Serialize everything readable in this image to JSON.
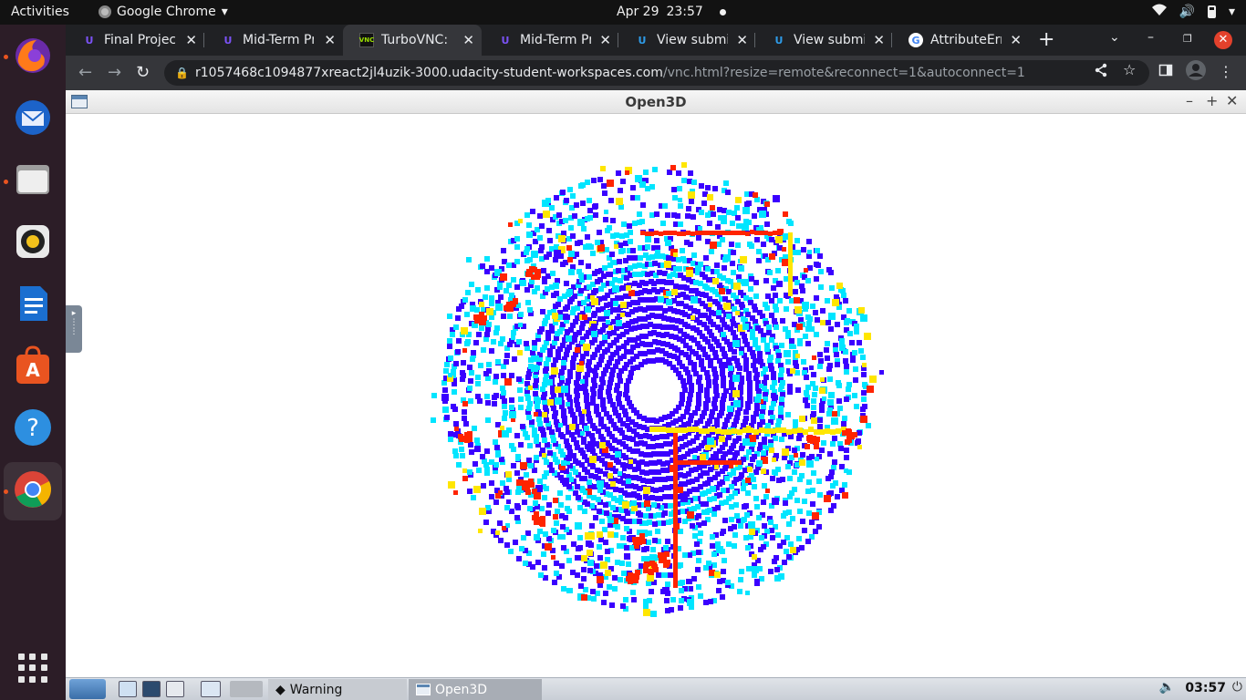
{
  "topbar": {
    "activities": "Activities",
    "app_menu": "Google Chrome",
    "date": "Apr 29",
    "time": "23:57"
  },
  "dock": {
    "items": [
      "firefox-icon",
      "thunderbird-icon",
      "files-icon",
      "rhythmbox-icon",
      "writer-icon",
      "software-icon",
      "help-icon",
      "chrome-icon"
    ]
  },
  "browser": {
    "tabs": [
      {
        "title": "Final Project",
        "favicon": "udacity-icon",
        "active": false
      },
      {
        "title": "Mid-Term Pr",
        "favicon": "udacity-icon",
        "active": false
      },
      {
        "title": "TurboVNC: u",
        "favicon": "vnc-icon",
        "active": true
      },
      {
        "title": "Mid-Term Pr",
        "favicon": "udacity-icon",
        "active": false
      },
      {
        "title": "View submit",
        "favicon": "udacity-icon",
        "active": false
      },
      {
        "title": "View submit",
        "favicon": "udacity-icon",
        "active": false
      },
      {
        "title": "AttributeErr",
        "favicon": "google-icon",
        "active": false
      }
    ],
    "url_host": "r1057468c1094877xreact2jl4uzik-3000.udacity-student-workspaces.com",
    "url_path": "/vnc.html?resize=remote&reconnect=1&autoconnect=1"
  },
  "vnc_window": {
    "title": "Open3D"
  },
  "taskbar": {
    "tasks": [
      {
        "label": "Warning",
        "icon": "warning-icon"
      },
      {
        "label": "Open3D",
        "icon": "window-icon"
      }
    ],
    "clock": "03:57"
  },
  "point_cloud": {
    "colormap": [
      "#3a00ff",
      "#00e5ff",
      "#ffe600",
      "#ff2400"
    ],
    "shape": "top-down lidar scan, radial rings of points, colored by height"
  }
}
